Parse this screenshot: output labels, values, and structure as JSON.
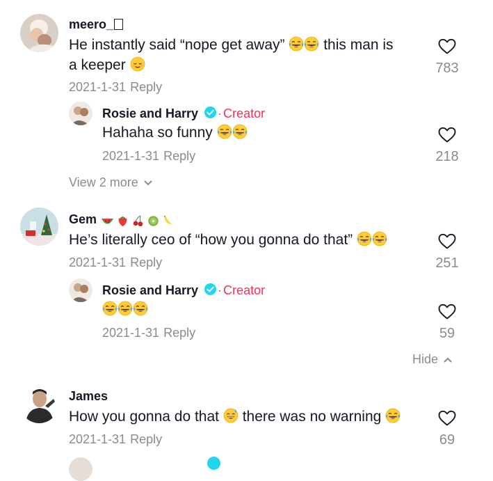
{
  "comments": [
    {
      "username": "meero_",
      "text_part1": "He instantly said “nope get away”",
      "text_part2": "this man is",
      "text_part3": "a keeper",
      "date": "2021-1-31",
      "reply_label": "Reply",
      "likes": "783",
      "replies": [
        {
          "username": "Rosie and Harry",
          "badge_sep": "·",
          "badge": "Creator",
          "text": "Hahaha so funny",
          "date": "2021-1-31",
          "reply_label": "Reply",
          "likes": "218"
        }
      ],
      "view_more_label": "View 2 more"
    },
    {
      "username": "Gem",
      "text": "He’s literally ceo of “how you gonna do that”",
      "date": "2021-1-31",
      "reply_label": "Reply",
      "likes": "251",
      "replies": [
        {
          "username": "Rosie and Harry",
          "badge_sep": "·",
          "badge": "Creator",
          "text": "",
          "date": "2021-1-31",
          "reply_label": "Reply",
          "likes": "59"
        }
      ],
      "hide_label": "Hide"
    },
    {
      "username": "James",
      "text_part1": "How you gonna do that",
      "text_part2": "there was no warning",
      "date": "2021-1-31",
      "reply_label": "Reply",
      "likes": "69"
    }
  ],
  "colors": {
    "username": "#161823",
    "secondary": "#8a8b91",
    "creator": "#fe2c55",
    "verified": "#20d5ec"
  },
  "icons": [
    "heart-outline-icon",
    "verified-badge-icon",
    "chevron-down-icon",
    "chevron-up-icon",
    "joy-emoji",
    "relieved-emoji",
    "sweat-smile-emoji",
    "watermelon-emoji",
    "strawberry-emoji",
    "cherries-emoji",
    "kiwi-emoji",
    "banana-emoji"
  ]
}
